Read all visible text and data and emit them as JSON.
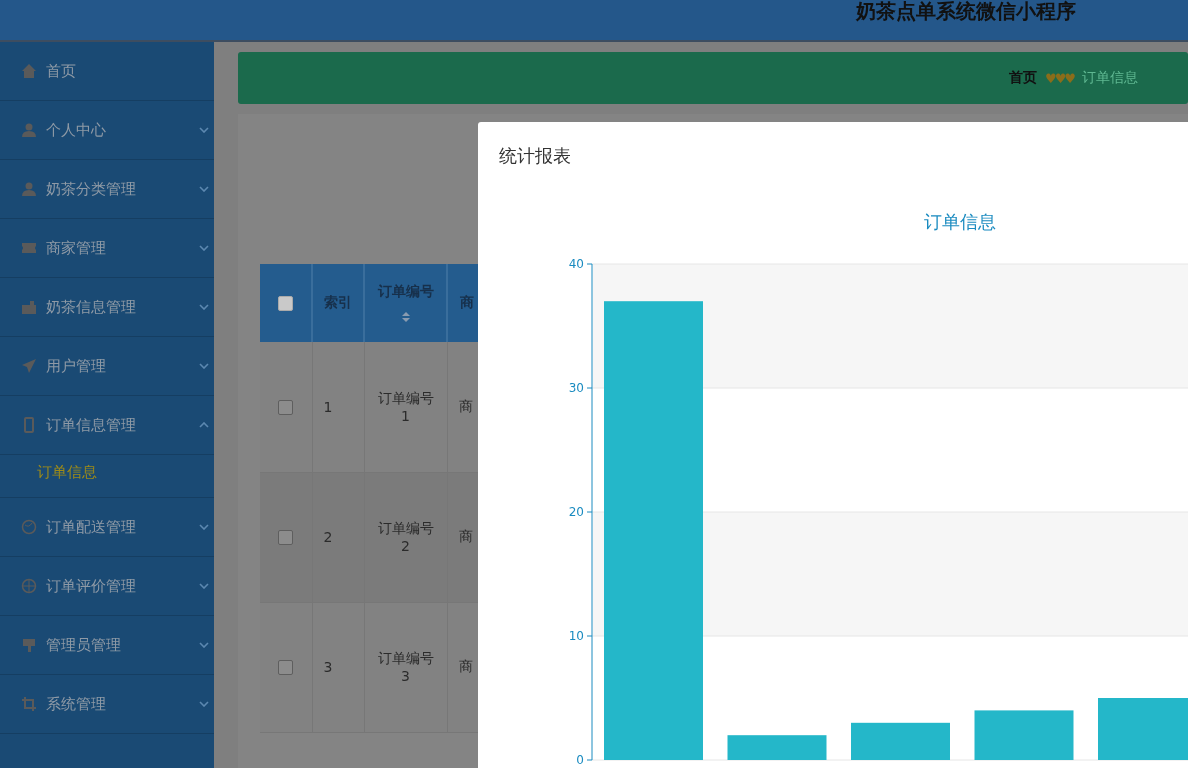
{
  "header": {
    "title": "奶茶点单系统微信小程序"
  },
  "sidebar": {
    "items": [
      {
        "label": "首页",
        "kind": "link"
      },
      {
        "label": "个人中心",
        "kind": "menu",
        "expanded": false
      },
      {
        "label": "奶茶分类管理",
        "kind": "menu",
        "expanded": false
      },
      {
        "label": "商家管理",
        "kind": "menu",
        "expanded": false
      },
      {
        "label": "奶茶信息管理",
        "kind": "menu",
        "expanded": false
      },
      {
        "label": "用户管理",
        "kind": "menu",
        "expanded": false
      },
      {
        "label": "订单信息管理",
        "kind": "menu",
        "expanded": true,
        "children": [
          {
            "label": "订单信息",
            "selected": true
          }
        ]
      },
      {
        "label": "订单配送管理",
        "kind": "menu",
        "expanded": false
      },
      {
        "label": "订单评价管理",
        "kind": "menu",
        "expanded": false
      },
      {
        "label": "管理员管理",
        "kind": "menu",
        "expanded": false
      },
      {
        "label": "系统管理",
        "kind": "menu",
        "expanded": false
      }
    ]
  },
  "breadcrumb": {
    "items": [
      "首页",
      "订单信息"
    ],
    "separator": "♥♥♥"
  },
  "table": {
    "select_all_checked": false,
    "columns": [
      {
        "label": "索引",
        "sortable": false
      },
      {
        "label": "订单编号",
        "sortable": true
      },
      {
        "label": "商",
        "sortable": false
      }
    ],
    "rows": [
      {
        "checked": false,
        "cells": [
          "1",
          "订单编号1",
          "商"
        ]
      },
      {
        "checked": false,
        "cells": [
          "2",
          "订单编号2",
          "商"
        ]
      },
      {
        "checked": false,
        "cells": [
          "3",
          "订单编号3",
          "商"
        ]
      }
    ]
  },
  "modal": {
    "title": "统计报表",
    "chart_data": {
      "type": "bar",
      "title": "订单信息",
      "ylim": [
        0,
        40
      ],
      "yticks": [
        0,
        10,
        20,
        30,
        40
      ],
      "grid": true,
      "series": [
        {
          "color": "#24b7c9",
          "values": [
            37,
            2,
            3,
            4,
            5
          ]
        }
      ]
    }
  }
}
